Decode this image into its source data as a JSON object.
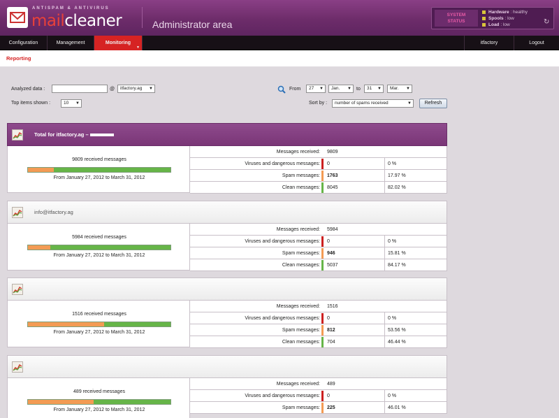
{
  "brand": {
    "tagline": "ANTISPAM & ANTIVIRUS",
    "name_part1": "mail",
    "name_part2": "cleaner",
    "area_title": "Administrator area"
  },
  "system_status": {
    "label_line1": "SYSTEM",
    "label_line2": "STATUS",
    "items": [
      {
        "name": "Hardware",
        "value": "healthy"
      },
      {
        "name": "Spools",
        "value": "low"
      },
      {
        "name": "Load",
        "value": "low"
      }
    ]
  },
  "nav": {
    "configuration": "Configuration",
    "management": "Management",
    "monitoring": "Monitoring",
    "user": "itfactory",
    "logout": "Logout"
  },
  "breadcrumb": "Reporting",
  "form": {
    "analyzed_label": "Analyzed data :",
    "analyzed_value": "",
    "at": "@",
    "domain": "itfactory.ag",
    "top_label": "Top items shown :",
    "top_value": "10",
    "from_label": "From",
    "from_day": "27",
    "from_month": "Jan.",
    "to_label": "to",
    "to_day": "31",
    "to_month": "Mar.",
    "sort_label": "Sort by :",
    "sort_value": "number of spams received",
    "refresh": "Refresh"
  },
  "labels": {
    "received": "Messages received:",
    "viruses": "Viruses and dangerous messages:",
    "spam": "Spam messages:",
    "clean": "Clean messages:"
  },
  "panels": [
    {
      "title": "Total for itfactory.ag –",
      "received_text": "9809 received messages",
      "range": "From January 27, 2012 to March 31, 2012",
      "received": "9809",
      "viruses": "0",
      "viruses_pct": "0 %",
      "spam": "1763",
      "spam_pct": "17.97 %",
      "clean": "8045",
      "clean_pct": "82.02 %",
      "spam_fraction": 0.1797
    },
    {
      "title": "info@itfactory.ag",
      "received_text": "5984 received messages",
      "range": "From January 27, 2012 to March 31, 2012",
      "received": "5984",
      "viruses": "0",
      "viruses_pct": "0 %",
      "spam": "946",
      "spam_pct": "15.81 %",
      "clean": "5037",
      "clean_pct": "84.17 %",
      "spam_fraction": 0.1581
    },
    {
      "title": "",
      "received_text": "1516 received messages",
      "range": "From January 27, 2012 to March 31, 2012",
      "received": "1516",
      "viruses": "0",
      "viruses_pct": "0 %",
      "spam": "812",
      "spam_pct": "53.56 %",
      "clean": "704",
      "clean_pct": "46.44 %",
      "spam_fraction": 0.5356
    },
    {
      "title": "",
      "received_text": "489 received messages",
      "range": "From January 27, 2012 to March 31, 2012",
      "received": "489",
      "viruses": "0",
      "viruses_pct": "0 %",
      "spam": "225",
      "spam_pct": "46.01 %",
      "spam_fraction": 0.4601
    }
  ],
  "colors": {
    "header": "#7a3677",
    "accent": "#d62323",
    "spam_bar": "#f39b54",
    "clean_bar": "#66b548"
  }
}
